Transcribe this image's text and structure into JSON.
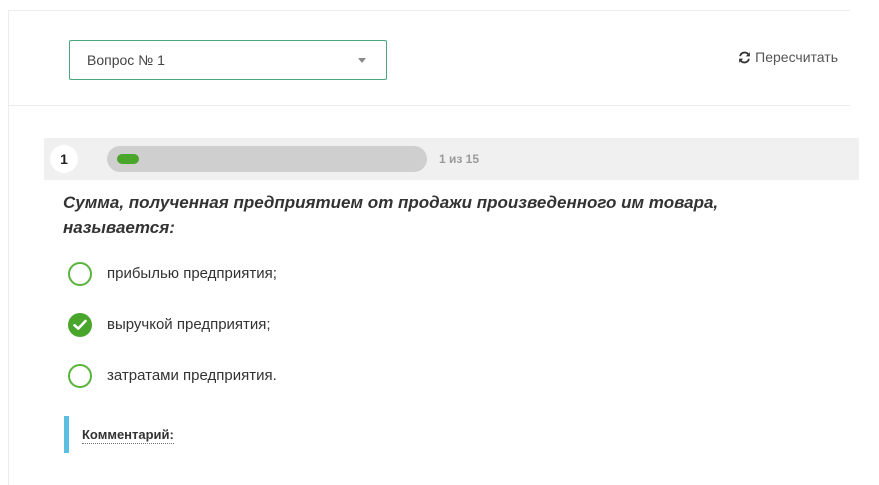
{
  "header": {
    "question_select": {
      "selected": "Вопрос № 1"
    },
    "recalc_label": "Пересчитать"
  },
  "progress": {
    "question_number": "1",
    "text": "1 из 15",
    "current": 1,
    "total": 15,
    "fill_fraction": 0.067
  },
  "question": {
    "text": "Сумма, полученная предприятием от продажи произведенного им товара, называется:"
  },
  "answers": [
    {
      "label": "прибылью предприятия;",
      "selected": false
    },
    {
      "label": "выручкой предприятия;",
      "selected": true
    },
    {
      "label": "затратами предприятия.",
      "selected": false
    }
  ],
  "comment": {
    "label": "Комментарий:"
  },
  "colors": {
    "accent_green": "#4aa52c",
    "select_border": "#48a77b",
    "comment_bar": "#5bbfe0",
    "progress_track": "#cfcfcf",
    "strip_background": "#f0f0f0"
  },
  "icons": {
    "recalc": "refresh-icon",
    "select_caret": "caret-down-icon",
    "selected_answer": "check-circle-icon"
  }
}
